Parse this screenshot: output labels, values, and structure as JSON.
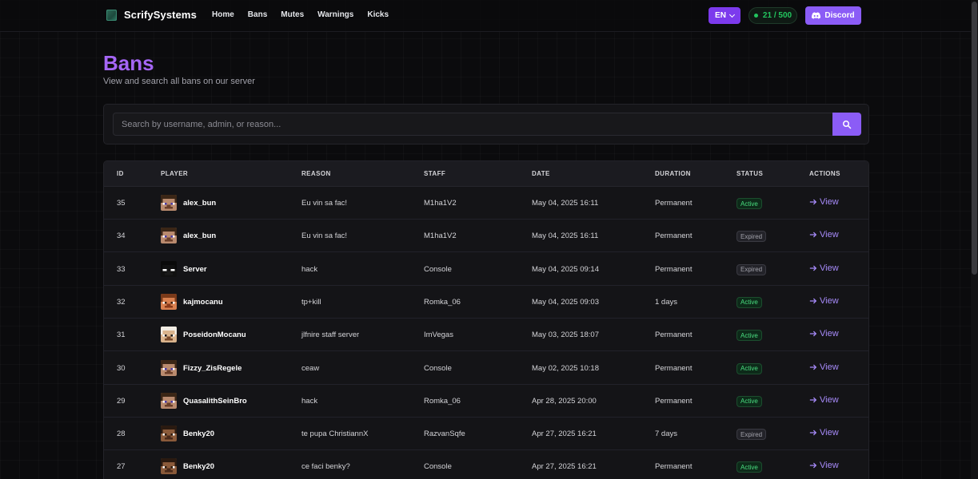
{
  "navbar": {
    "brand": "ScrifySystems",
    "links": [
      "Home",
      "Bans",
      "Mutes",
      "Warnings",
      "Kicks"
    ],
    "language": "EN",
    "players_online": "21 / 500",
    "discord_label": "Discord"
  },
  "page": {
    "title": "Bans",
    "subtitle": "View and search all bans on our server"
  },
  "search": {
    "placeholder": "Search by username, admin, or reason..."
  },
  "table": {
    "headers": [
      "ID",
      "PLAYER",
      "REASON",
      "STAFF",
      "DATE",
      "DURATION",
      "STATUS",
      "ACTIONS"
    ],
    "view_label": "View",
    "rows": [
      {
        "id": "35",
        "player": "alex_bun",
        "reason": "Eu vin sa fac!",
        "staff": "M1ha1V2",
        "date": "May 04, 2025 16:11",
        "duration": "Permanent",
        "status": "Active",
        "skin": "steve"
      },
      {
        "id": "34",
        "player": "alex_bun",
        "reason": "Eu vin sa fac!",
        "staff": "M1ha1V2",
        "date": "May 04, 2025 16:11",
        "duration": "Permanent",
        "status": "Expired",
        "skin": "steve"
      },
      {
        "id": "33",
        "player": "Server",
        "reason": "hack",
        "staff": "Console",
        "date": "May 04, 2025 09:14",
        "duration": "Permanent",
        "status": "Expired",
        "skin": "dark"
      },
      {
        "id": "32",
        "player": "kajmocanu",
        "reason": "tp+kill",
        "staff": "Romka_06",
        "date": "May 04, 2025 09:03",
        "duration": "1 days",
        "status": "Active",
        "skin": "orange"
      },
      {
        "id": "31",
        "player": "PoseidonMocanu",
        "reason": "jlfnire staff server",
        "staff": "ImVegas",
        "date": "May 03, 2025 18:07",
        "duration": "Permanent",
        "status": "Active",
        "skin": "white"
      },
      {
        "id": "30",
        "player": "Fizzy_ZisRegele",
        "reason": "ceaw",
        "staff": "Console",
        "date": "May 02, 2025 10:18",
        "duration": "Permanent",
        "status": "Active",
        "skin": "steve"
      },
      {
        "id": "29",
        "player": "QuasalithSeinBro",
        "reason": "hack",
        "staff": "Romka_06",
        "date": "Apr 28, 2025 20:00",
        "duration": "Permanent",
        "status": "Active",
        "skin": "steve"
      },
      {
        "id": "28",
        "player": "Benky20",
        "reason": "te pupa ChristiannX",
        "staff": "RazvanSqfe",
        "date": "Apr 27, 2025 16:21",
        "duration": "7 days",
        "status": "Expired",
        "skin": "brown"
      },
      {
        "id": "27",
        "player": "Benky20",
        "reason": "ce faci benky?",
        "staff": "Console",
        "date": "Apr 27, 2025 16:21",
        "duration": "Permanent",
        "status": "Active",
        "skin": "brown"
      }
    ]
  },
  "colors": {
    "accent": "#8b5cf6",
    "title": "#a566f5",
    "active": "#4ade80",
    "online": "#22c55e"
  }
}
